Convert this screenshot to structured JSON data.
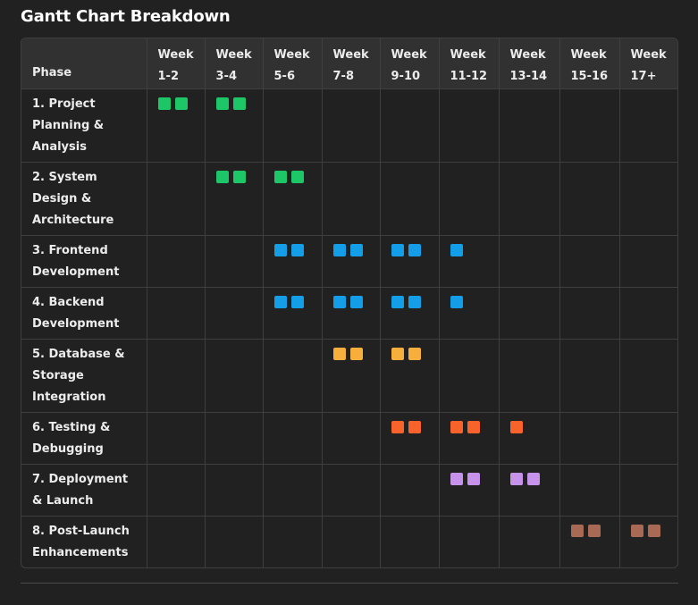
{
  "title": "Gantt Chart Breakdown",
  "header": {
    "phase": "Phase",
    "weeks": [
      "Week\n1-2",
      "Week\n3-4",
      "Week\n5-6",
      "Week\n7-8",
      "Week\n9-10",
      "Week\n11-12",
      "Week\n13-14",
      "Week\n15-16",
      "Week\n17+"
    ]
  },
  "colors": {
    "green": "#1dc667",
    "blue": "#149ee8",
    "yellow": "#f6ae3c",
    "orange": "#f8622b",
    "purple": "#c792ea",
    "brown": "#a86a55"
  },
  "rows": [
    {
      "phase": "1. Project Planning & Analysis",
      "color": "green",
      "blocks": [
        2,
        2,
        0,
        0,
        0,
        0,
        0,
        0,
        0
      ]
    },
    {
      "phase": "2. System Design & Architecture",
      "color": "green",
      "blocks": [
        0,
        2,
        2,
        0,
        0,
        0,
        0,
        0,
        0
      ]
    },
    {
      "phase": "3. Frontend Development",
      "color": "blue",
      "blocks": [
        0,
        0,
        2,
        2,
        2,
        1,
        0,
        0,
        0
      ]
    },
    {
      "phase": "4. Backend Development",
      "color": "blue",
      "blocks": [
        0,
        0,
        2,
        2,
        2,
        1,
        0,
        0,
        0
      ]
    },
    {
      "phase": "5. Database & Storage Integration",
      "color": "yellow",
      "blocks": [
        0,
        0,
        0,
        2,
        2,
        0,
        0,
        0,
        0
      ]
    },
    {
      "phase": "6. Testing & Debugging",
      "color": "orange",
      "blocks": [
        0,
        0,
        0,
        0,
        2,
        2,
        1,
        0,
        0
      ]
    },
    {
      "phase": "7. Deployment & Launch",
      "color": "purple",
      "blocks": [
        0,
        0,
        0,
        0,
        0,
        2,
        2,
        0,
        0
      ]
    },
    {
      "phase": "8. Post-Launch Enhancements",
      "color": "brown",
      "blocks": [
        0,
        0,
        0,
        0,
        0,
        0,
        0,
        2,
        2
      ]
    }
  ]
}
